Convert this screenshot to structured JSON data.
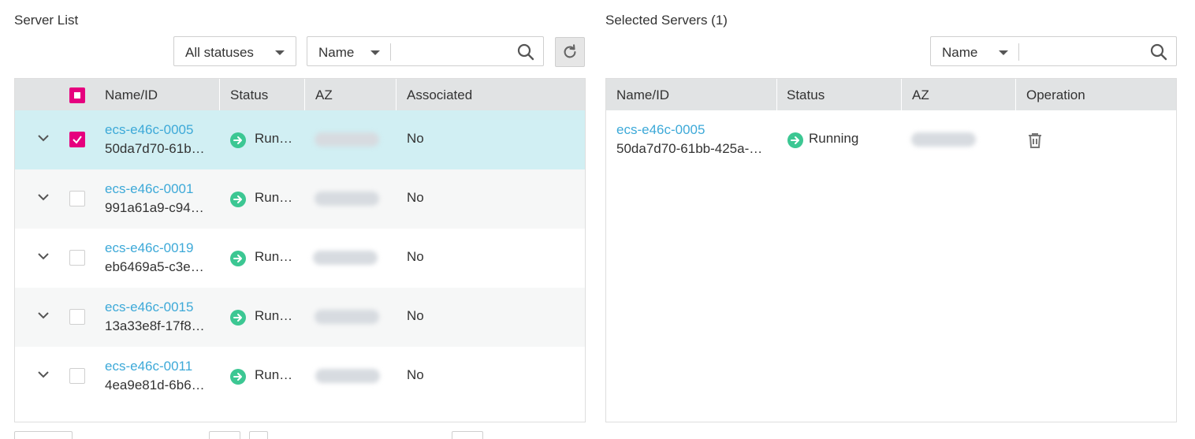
{
  "left_panel": {
    "title": "Server List",
    "status_filter": {
      "value": "All statuses"
    },
    "search": {
      "field": "Name",
      "value": ""
    },
    "columns": [
      "Name/ID",
      "Status",
      "AZ",
      "Associated"
    ],
    "rows": [
      {
        "name": "ecs-e46c-0005",
        "id": "50da7d70-61b…",
        "status": "Run…",
        "associated": "No",
        "checked": true,
        "selected": true
      },
      {
        "name": "ecs-e46c-0001",
        "id": "991a61a9-c94…",
        "status": "Run…",
        "associated": "No",
        "checked": false,
        "selected": false
      },
      {
        "name": "ecs-e46c-0019",
        "id": "eb6469a5-c3e…",
        "status": "Run…",
        "associated": "No",
        "checked": false,
        "selected": false
      },
      {
        "name": "ecs-e46c-0015",
        "id": "13a33e8f-17f8…",
        "status": "Run…",
        "associated": "No",
        "checked": false,
        "selected": false
      },
      {
        "name": "ecs-e46c-0011",
        "id": "4ea9e81d-6b6…",
        "status": "Run…",
        "associated": "No",
        "checked": false,
        "selected": false
      }
    ]
  },
  "right_panel": {
    "title": "Selected Servers (1)",
    "search": {
      "field": "Name",
      "value": ""
    },
    "columns": [
      "Name/ID",
      "Status",
      "AZ",
      "Operation"
    ],
    "rows": [
      {
        "name": "ecs-e46c-0005",
        "id": "50da7d70-61bb-425a-…",
        "status": "Running"
      }
    ]
  },
  "icons": {
    "search": "search-icon",
    "refresh": "refresh-icon",
    "expand": "chevron-down-icon",
    "status": "running-arrow-icon",
    "delete": "trash-icon"
  },
  "colors": {
    "link": "#3da9d8",
    "checkbox_accent": "#e6007e",
    "running": "#3cc793",
    "selected_row": "#d1eff3",
    "alt_row": "#f6f7f7",
    "header_bg": "#e1e3e4"
  }
}
